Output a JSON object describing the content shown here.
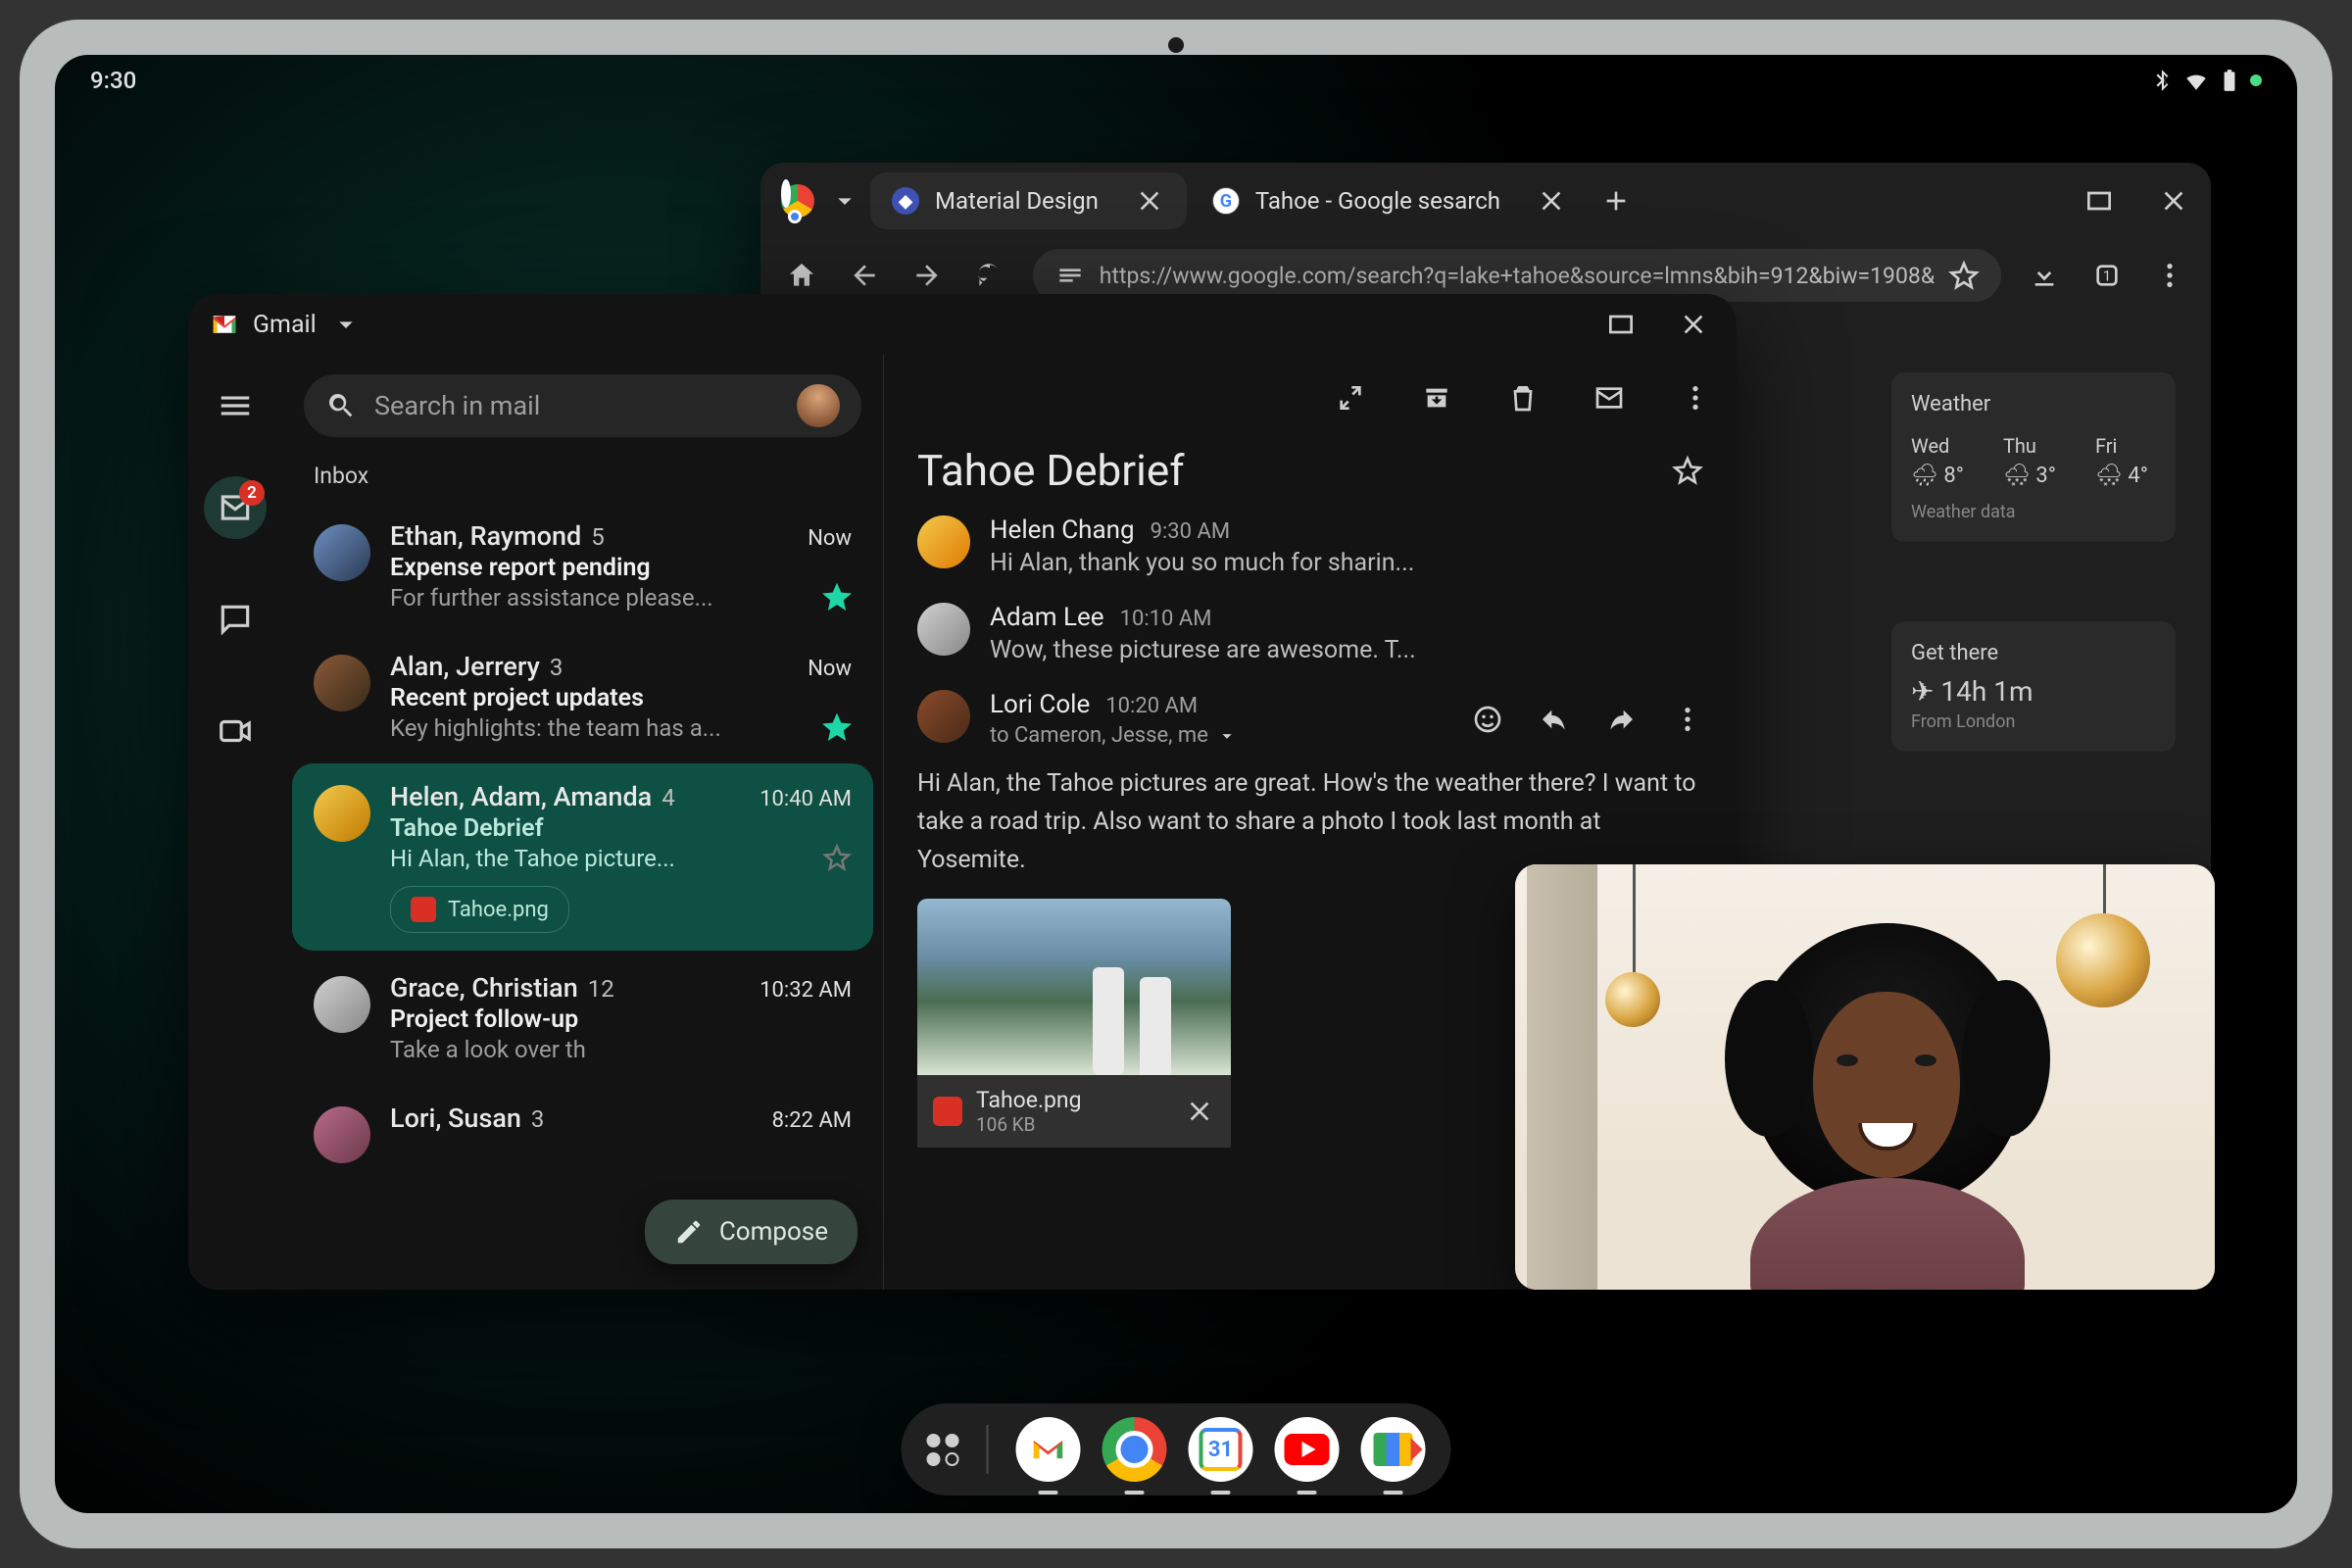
{
  "status": {
    "time": "9:30"
  },
  "browser": {
    "tabs": [
      {
        "label": "Material Design",
        "favicon": "material-icon"
      },
      {
        "label": "Tahoe - Google sesarch",
        "favicon": "google-g-icon"
      }
    ],
    "new_tab": "+",
    "nav": {
      "url": "https://www.google.com/search?q=lake+tahoe&source=lmns&bih=912&biw=1908&"
    },
    "weather": {
      "title": "Weather",
      "days": [
        {
          "label": "Wed",
          "icon": "rain-icon",
          "temp": "8°"
        },
        {
          "label": "Thu",
          "icon": "snow-icon",
          "temp": "3°"
        },
        {
          "label": "Fri",
          "icon": "snow-icon",
          "temp": "4°"
        }
      ],
      "footer": "Weather data"
    },
    "directions": {
      "title": "Get there",
      "duration": "14h 1m",
      "via_prefix": "✈  ",
      "from": "From London"
    }
  },
  "gmail": {
    "title": "Gmail",
    "search_placeholder": "Search in mail",
    "nav_badge": "2",
    "inbox_label": "Inbox",
    "compose": "Compose",
    "threads": [
      {
        "sender": "Ethan, Raymond",
        "count": "5",
        "time": "Now",
        "subject": "Expense report pending",
        "preview": "For further assistance please...",
        "starred": true
      },
      {
        "sender": "Alan, Jerrery",
        "count": "3",
        "time": "Now",
        "subject": "Recent project updates",
        "preview": "Key highlights: the team has a...",
        "starred": true
      },
      {
        "sender": "Helen, Adam, Amanda",
        "count": "4",
        "time": "10:40 AM",
        "subject": "Tahoe Debrief",
        "preview": "Hi Alan, the Tahoe picture...",
        "attachment": "Tahoe.png",
        "selected": true
      },
      {
        "sender": "Grace, Christian",
        "count": "12",
        "time": "10:32 AM",
        "subject": "Project follow-up",
        "preview": "Take a look over th"
      },
      {
        "sender": "Lori, Susan",
        "count": "3",
        "time": "8:22 AM",
        "subject": "",
        "preview": ""
      }
    ],
    "detail": {
      "subject": "Tahoe Debrief",
      "messages": [
        {
          "name": "Helen Chang",
          "time": "9:30 AM",
          "preview": "Hi Alan, thank you so much for sharin..."
        },
        {
          "name": "Adam Lee",
          "time": "10:10 AM",
          "preview": "Wow, these picturese are awesome. T..."
        },
        {
          "name": "Lori Cole",
          "time": "10:20 AM",
          "to": "to Cameron, Jesse, me"
        }
      ],
      "body": "Hi Alan, the Tahoe pictures are great. How's the weather there? I want to take a road trip. Also want to share a photo I took last month at Yosemite.",
      "attachment": {
        "name": "Tahoe.png",
        "size": "106 KB"
      }
    }
  },
  "taskbar": {
    "apps": [
      "Gmail",
      "Chrome",
      "Calendar",
      "YouTube",
      "Meet"
    ],
    "cal_day": "31"
  }
}
